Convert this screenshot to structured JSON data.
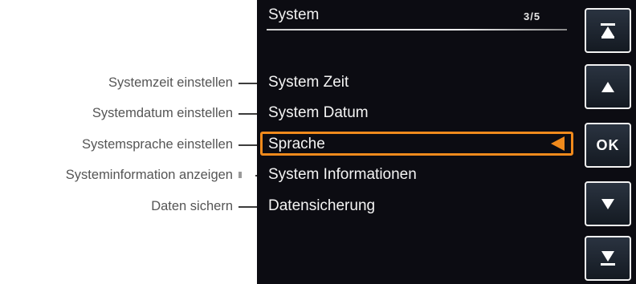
{
  "annotations": [
    {
      "text": "Systemzeit einstellen"
    },
    {
      "text": "Systemdatum einstellen"
    },
    {
      "text": "Systemsprache einstellen"
    },
    {
      "text": "Systeminformation anzeigen"
    },
    {
      "text": "Daten sichern"
    }
  ],
  "screen": {
    "title": "System",
    "page_indicator": "3/5",
    "menu": [
      {
        "label": "System Zeit"
      },
      {
        "label": "System Datum"
      },
      {
        "label": "Sprache",
        "selected": true
      },
      {
        "label": "System Informationen"
      },
      {
        "label": "Datensicherung"
      }
    ]
  },
  "buttons": {
    "first_page": {
      "icon": "jump-to-first-icon"
    },
    "up": {
      "icon": "arrow-up-icon"
    },
    "ok": {
      "label": "OK"
    },
    "down": {
      "icon": "arrow-down-icon"
    },
    "last_page": {
      "icon": "jump-to-last-icon"
    }
  },
  "colors": {
    "screen_bg": "#0c0c12",
    "selection": "#f08a1c",
    "annotation_text": "#555555"
  }
}
